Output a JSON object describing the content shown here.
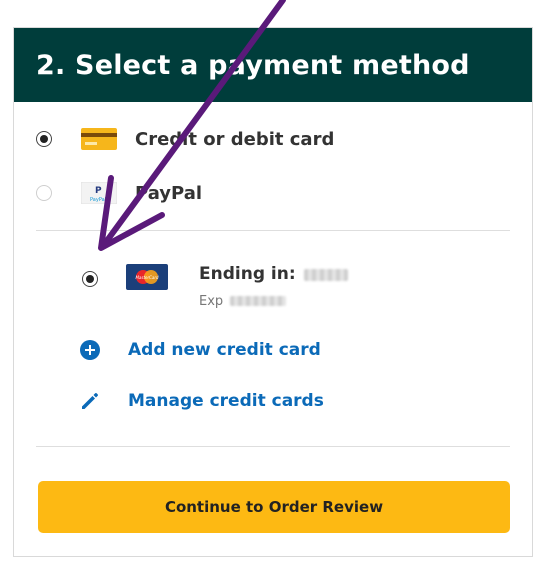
{
  "header": {
    "title": "2. Select a payment method"
  },
  "payment_options": [
    {
      "label": "Credit or debit card",
      "icon": "credit-card-icon",
      "selected": true
    },
    {
      "label": "PayPal",
      "icon": "paypal-icon",
      "selected": false
    }
  ],
  "saved_card": {
    "ending_label": "Ending in:",
    "exp_label": "Exp",
    "card_brand": "MasterCard",
    "selected": true
  },
  "actions": {
    "add_card": "Add new credit card",
    "manage_cards": "Manage credit cards"
  },
  "continue_button": {
    "label": "Continue to Order Review"
  },
  "colors": {
    "header_bg": "#003d3b",
    "link": "#0b6ab8",
    "button": "#fdb913",
    "annotation_arrow": "#5a1a7a"
  }
}
